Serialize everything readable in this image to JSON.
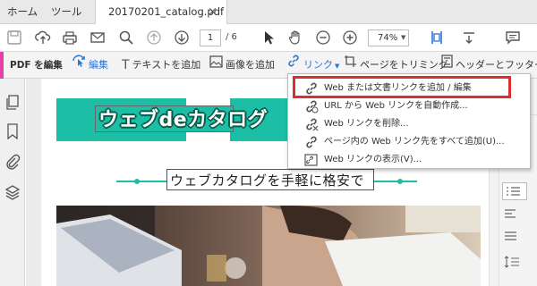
{
  "tabs": {
    "home": "ホーム",
    "tools": "ツール",
    "document": "20170201_catalog.pdf",
    "close": "×"
  },
  "toolbar": {
    "page_current": "1",
    "page_total": "/ 6",
    "zoom": "74%"
  },
  "editbar": {
    "label": "PDF を編集",
    "edit": "編集",
    "add_text": "テキストを追加",
    "add_image": "画像を追加",
    "link": "リンク",
    "crop": "ページをトリミング",
    "header_footer": "ヘッダーとフッター"
  },
  "document": {
    "title": "ウェブdeカタログ",
    "subtitle": "ウェブカタログを手軽に格安で"
  },
  "link_menu": {
    "items": [
      "Web または文書リンクを追加 / 編集",
      "URL から Web リンクを自動作成...",
      "Web リンクを削除...",
      "ページ内の Web リンク先をすべて追加(U)...",
      "Web リンクの表示(V)..."
    ]
  },
  "colors": {
    "accent_teal": "#1cbfa6",
    "highlight_red": "#d8302f",
    "active_blue": "#2a74d5",
    "edit_pink": "#e63fa8"
  }
}
